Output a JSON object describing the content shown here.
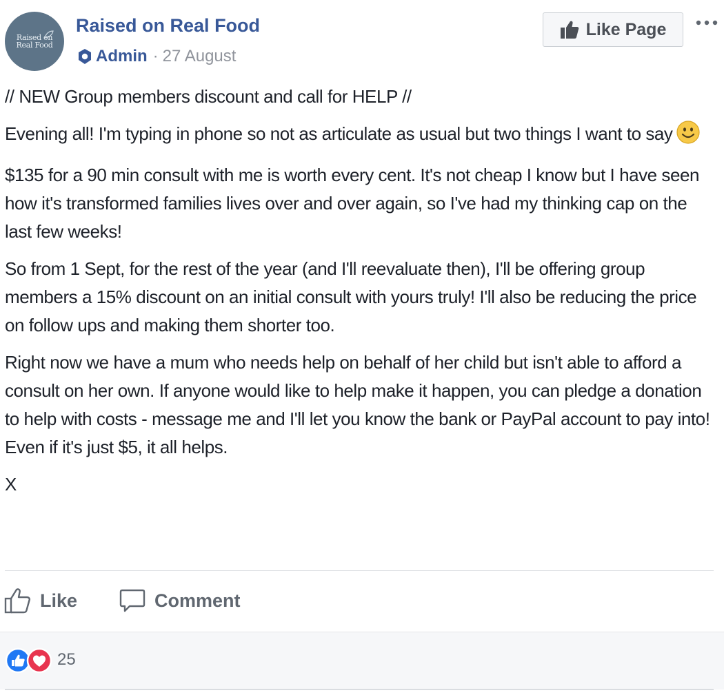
{
  "post": {
    "page_name": "Raised on Real Food",
    "avatar_text": "Raised on Real Food",
    "role": "Admin",
    "separator": "·",
    "date": "27 August",
    "like_page_label": "Like Page",
    "more_icon": "more-horizontal-icon",
    "paragraphs": [
      "// NEW Group members discount and call for HELP //",
      "Evening all! I'm typing in phone so not as articulate as usual but two things I want to say",
      "$135 for a 90 min consult with me is worth every cent. It's not cheap I know but I have seen how it's transformed families lives over and over again, so I've had my thinking cap on the last few weeks!",
      "So from 1 Sept, for the rest of the year (and I'll reevaluate then), I'll be offering group members a 15% discount on an initial consult with yours truly! I'll also be reducing the price on follow ups and making them shorter too.",
      "Right now we have a mum who needs help on behalf of her child but isn't able to afford a consult on her own. If anyone would like to help make it happen, you can pledge a donation to help with costs - message me and I'll let you know the bank or PayPal account to pay into! Even if it's just $5, it all helps.",
      "X"
    ],
    "emoji": "smile-emoji-icon"
  },
  "actions": {
    "like_label": "Like",
    "comment_label": "Comment"
  },
  "reactions": {
    "count": "25",
    "types": [
      "like-reaction-icon",
      "love-reaction-icon"
    ]
  },
  "colors": {
    "link_blue": "#385898",
    "meta_gray": "#90949c",
    "action_gray": "#606770",
    "like_blue": "#2078f4",
    "love_red": "#e8344f",
    "avatar_bg": "#5d7488"
  }
}
